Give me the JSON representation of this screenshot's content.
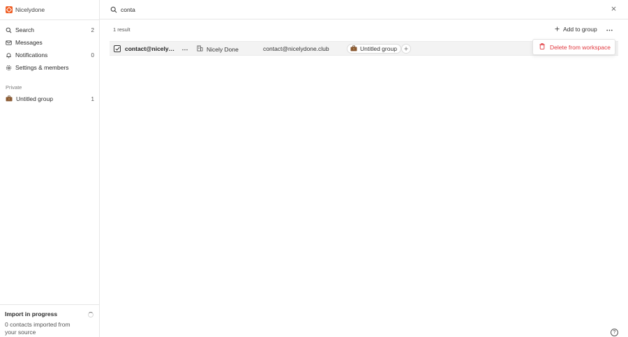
{
  "app": {
    "name": "Nicelydone",
    "brand_color": "#f05d23"
  },
  "sidebar": {
    "items": [
      {
        "label": "Search",
        "count": "2",
        "icon": "search-icon"
      },
      {
        "label": "Messages",
        "count": "",
        "icon": "mail-icon"
      },
      {
        "label": "Notifications",
        "count": "0",
        "icon": "bell-icon"
      },
      {
        "label": "Settings & members",
        "count": "",
        "icon": "gear-icon"
      }
    ],
    "section_label": "Private",
    "group": {
      "label": "Untitled group",
      "count": "1",
      "icon": "briefcase-icon"
    },
    "import": {
      "title": "Import in progress",
      "text": "0 contacts imported from your source"
    }
  },
  "search": {
    "value": "conta",
    "placeholder": ""
  },
  "results": {
    "count_label": "1 result",
    "add_to_group_label": "Add to group",
    "rows": [
      {
        "name": "contact@nicelydone.club",
        "company": "Nicely Done",
        "email": "contact@nicelydone.club",
        "group": "Untitled group",
        "checked": true
      }
    ]
  },
  "menu": {
    "delete_label": "Delete from workspace",
    "danger_color": "#e0383e"
  }
}
